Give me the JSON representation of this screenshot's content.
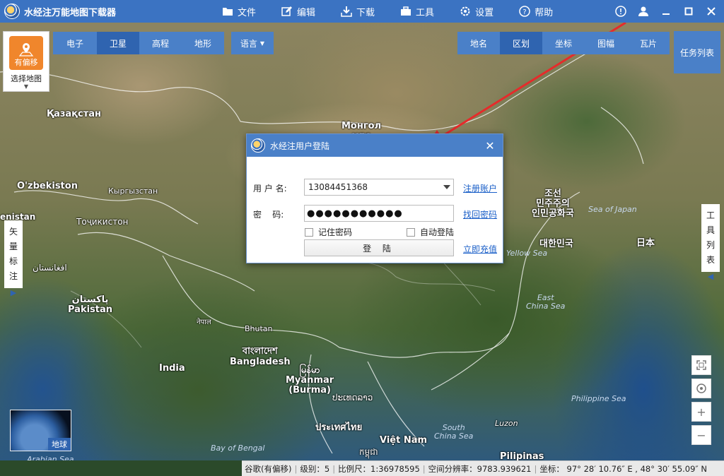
{
  "app": {
    "title": "水经注万能地图下载器"
  },
  "menu": [
    {
      "label": "文件",
      "icon": "folder-icon"
    },
    {
      "label": "编辑",
      "icon": "edit-icon"
    },
    {
      "label": "下载",
      "icon": "download-icon"
    },
    {
      "label": "工具",
      "icon": "toolbox-icon"
    },
    {
      "label": "设置",
      "icon": "gear-icon"
    },
    {
      "label": "帮助",
      "icon": "help-icon"
    }
  ],
  "map_types": [
    "电子",
    "卫星",
    "高程",
    "地形"
  ],
  "map_type_active": "卫星",
  "language_label": "语言",
  "overlays": [
    "地名",
    "区划",
    "坐标",
    "图幅",
    "瓦片"
  ],
  "overlay_active": "区划",
  "task_list_label": "任务列表",
  "select_map": {
    "badge": "有偏移",
    "label": "选择地图"
  },
  "left_sidetab": {
    "chars": [
      "矢",
      "量",
      "标",
      "注"
    ]
  },
  "right_sidetab": {
    "chars": [
      "工",
      "具",
      "列",
      "表"
    ]
  },
  "globe_label": "地球",
  "map_labels": {
    "kazakhstan": "Қазақстан",
    "mongolia": "Монгол\nулс",
    "uzbekistan": "O'zbekiston",
    "kyrgyzstan": "Кыргызстан",
    "tajikistan": "Тоҷикистон",
    "afghanistan": "افغانستان",
    "pakistan": "پاکستان\nPakistan",
    "nepal": "नेपाल",
    "bhutan": "Bhutan",
    "bangladesh": "বাংলাদেশ\nBangladesh",
    "india": "India",
    "myanmar": "မြန်မာ\nMyanmar\n(Burma)",
    "laos": "ປະເທດລາວ",
    "thailand": "ประเทศไทย",
    "vietnam": "Việt Nam",
    "cambodia": "កម្ពុជា",
    "north_korea": "조선\n민주주의\n인민공화국",
    "south_korea": "대한민국",
    "japan": "日本",
    "philippines": "Pilipinas",
    "luzon": "Luzon",
    "sea_of_japan": "Sea of Japan",
    "yellow_sea": "Yellow Sea",
    "east_china_sea": "East\nChina Sea",
    "south_china_sea": "South\nChina Sea",
    "philippine_sea": "Philippine Sea",
    "bay_of_bengal": "Bay of Bengal",
    "arabian_sea": "Arabian Sea",
    "iran_partial": "enistan"
  },
  "dialog": {
    "title": "水经注用户登陆",
    "username_label": "用 户 名:",
    "username_value": "13084451368",
    "password_label": "密    码:",
    "password_value": "●●●●●●●●●●●",
    "register_link": "注册账户",
    "recover_link": "找回密码",
    "recharge_link": "立即充值",
    "remember_label": "记住密码",
    "autologin_label": "自动登陆",
    "login_button": "登  陆"
  },
  "status": {
    "source": "谷歌(有偏移)",
    "level": "级别：5",
    "scale": "比例尺：1:36978595",
    "resolution": "空间分辨率：9783.939621",
    "coord": "坐标：  97° 28′ 10.76″ E , 48° 30′ 55.09″ N"
  },
  "colors": {
    "accent": "#4a80c8",
    "active": "#2f64b0",
    "titlebar": "#3b73c2"
  }
}
